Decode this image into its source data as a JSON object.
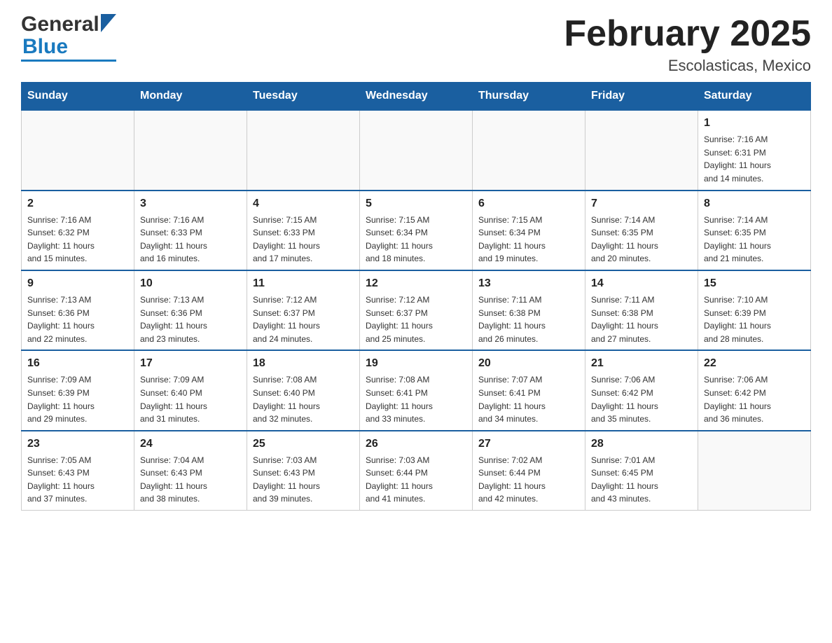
{
  "header": {
    "title": "February 2025",
    "subtitle": "Escolasticas, Mexico",
    "logo_general": "General",
    "logo_blue": "Blue"
  },
  "weekdays": [
    "Sunday",
    "Monday",
    "Tuesday",
    "Wednesday",
    "Thursday",
    "Friday",
    "Saturday"
  ],
  "weeks": [
    [
      {
        "day": "",
        "info": ""
      },
      {
        "day": "",
        "info": ""
      },
      {
        "day": "",
        "info": ""
      },
      {
        "day": "",
        "info": ""
      },
      {
        "day": "",
        "info": ""
      },
      {
        "day": "",
        "info": ""
      },
      {
        "day": "1",
        "info": "Sunrise: 7:16 AM\nSunset: 6:31 PM\nDaylight: 11 hours\nand 14 minutes."
      }
    ],
    [
      {
        "day": "2",
        "info": "Sunrise: 7:16 AM\nSunset: 6:32 PM\nDaylight: 11 hours\nand 15 minutes."
      },
      {
        "day": "3",
        "info": "Sunrise: 7:16 AM\nSunset: 6:33 PM\nDaylight: 11 hours\nand 16 minutes."
      },
      {
        "day": "4",
        "info": "Sunrise: 7:15 AM\nSunset: 6:33 PM\nDaylight: 11 hours\nand 17 minutes."
      },
      {
        "day": "5",
        "info": "Sunrise: 7:15 AM\nSunset: 6:34 PM\nDaylight: 11 hours\nand 18 minutes."
      },
      {
        "day": "6",
        "info": "Sunrise: 7:15 AM\nSunset: 6:34 PM\nDaylight: 11 hours\nand 19 minutes."
      },
      {
        "day": "7",
        "info": "Sunrise: 7:14 AM\nSunset: 6:35 PM\nDaylight: 11 hours\nand 20 minutes."
      },
      {
        "day": "8",
        "info": "Sunrise: 7:14 AM\nSunset: 6:35 PM\nDaylight: 11 hours\nand 21 minutes."
      }
    ],
    [
      {
        "day": "9",
        "info": "Sunrise: 7:13 AM\nSunset: 6:36 PM\nDaylight: 11 hours\nand 22 minutes."
      },
      {
        "day": "10",
        "info": "Sunrise: 7:13 AM\nSunset: 6:36 PM\nDaylight: 11 hours\nand 23 minutes."
      },
      {
        "day": "11",
        "info": "Sunrise: 7:12 AM\nSunset: 6:37 PM\nDaylight: 11 hours\nand 24 minutes."
      },
      {
        "day": "12",
        "info": "Sunrise: 7:12 AM\nSunset: 6:37 PM\nDaylight: 11 hours\nand 25 minutes."
      },
      {
        "day": "13",
        "info": "Sunrise: 7:11 AM\nSunset: 6:38 PM\nDaylight: 11 hours\nand 26 minutes."
      },
      {
        "day": "14",
        "info": "Sunrise: 7:11 AM\nSunset: 6:38 PM\nDaylight: 11 hours\nand 27 minutes."
      },
      {
        "day": "15",
        "info": "Sunrise: 7:10 AM\nSunset: 6:39 PM\nDaylight: 11 hours\nand 28 minutes."
      }
    ],
    [
      {
        "day": "16",
        "info": "Sunrise: 7:09 AM\nSunset: 6:39 PM\nDaylight: 11 hours\nand 29 minutes."
      },
      {
        "day": "17",
        "info": "Sunrise: 7:09 AM\nSunset: 6:40 PM\nDaylight: 11 hours\nand 31 minutes."
      },
      {
        "day": "18",
        "info": "Sunrise: 7:08 AM\nSunset: 6:40 PM\nDaylight: 11 hours\nand 32 minutes."
      },
      {
        "day": "19",
        "info": "Sunrise: 7:08 AM\nSunset: 6:41 PM\nDaylight: 11 hours\nand 33 minutes."
      },
      {
        "day": "20",
        "info": "Sunrise: 7:07 AM\nSunset: 6:41 PM\nDaylight: 11 hours\nand 34 minutes."
      },
      {
        "day": "21",
        "info": "Sunrise: 7:06 AM\nSunset: 6:42 PM\nDaylight: 11 hours\nand 35 minutes."
      },
      {
        "day": "22",
        "info": "Sunrise: 7:06 AM\nSunset: 6:42 PM\nDaylight: 11 hours\nand 36 minutes."
      }
    ],
    [
      {
        "day": "23",
        "info": "Sunrise: 7:05 AM\nSunset: 6:43 PM\nDaylight: 11 hours\nand 37 minutes."
      },
      {
        "day": "24",
        "info": "Sunrise: 7:04 AM\nSunset: 6:43 PM\nDaylight: 11 hours\nand 38 minutes."
      },
      {
        "day": "25",
        "info": "Sunrise: 7:03 AM\nSunset: 6:43 PM\nDaylight: 11 hours\nand 39 minutes."
      },
      {
        "day": "26",
        "info": "Sunrise: 7:03 AM\nSunset: 6:44 PM\nDaylight: 11 hours\nand 41 minutes."
      },
      {
        "day": "27",
        "info": "Sunrise: 7:02 AM\nSunset: 6:44 PM\nDaylight: 11 hours\nand 42 minutes."
      },
      {
        "day": "28",
        "info": "Sunrise: 7:01 AM\nSunset: 6:45 PM\nDaylight: 11 hours\nand 43 minutes."
      },
      {
        "day": "",
        "info": ""
      }
    ]
  ]
}
